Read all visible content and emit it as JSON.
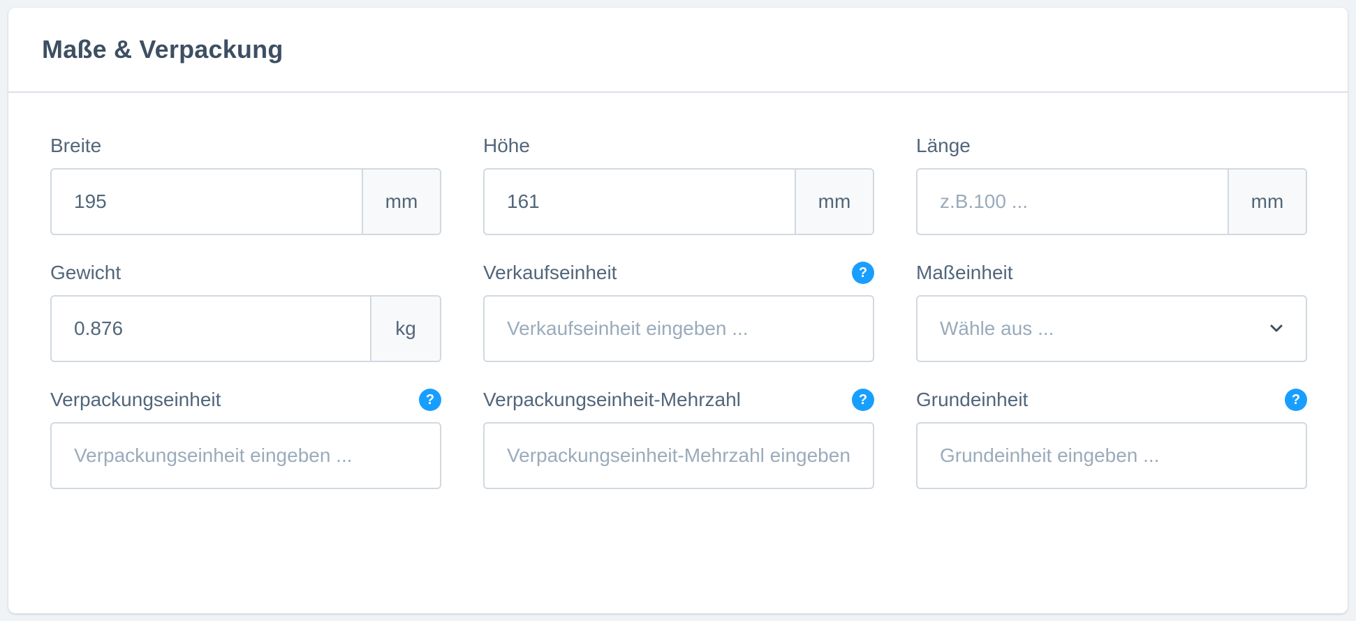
{
  "card": {
    "title": "Maße & Verpackung"
  },
  "fields": {
    "breite": {
      "label": "Breite",
      "value": "195",
      "unit": "mm"
    },
    "hoehe": {
      "label": "Höhe",
      "value": "161",
      "unit": "mm"
    },
    "laenge": {
      "label": "Länge",
      "value": "",
      "placeholder": "z.B.100 ...",
      "unit": "mm"
    },
    "gewicht": {
      "label": "Gewicht",
      "value": "0.876",
      "unit": "kg"
    },
    "verkaufseinheit": {
      "label": "Verkaufseinheit",
      "value": "",
      "placeholder": "Verkaufseinheit eingeben ..."
    },
    "masseinheit": {
      "label": "Maßeinheit",
      "selected": "Wähle aus ..."
    },
    "verpackungseinheit": {
      "label": "Verpackungseinheit",
      "value": "",
      "placeholder": "Verpackungseinheit eingeben ..."
    },
    "verpackungseinheit_mehrzahl": {
      "label": "Verpackungseinheit-Mehrzahl",
      "value": "",
      "placeholder": "Verpackungseinheit-Mehrzahl eingeben ..."
    },
    "grundeinheit": {
      "label": "Grundeinheit",
      "value": "",
      "placeholder": "Grundeinheit eingeben ..."
    }
  },
  "help_icon": {
    "glyph": "?",
    "color": "#189eff"
  }
}
